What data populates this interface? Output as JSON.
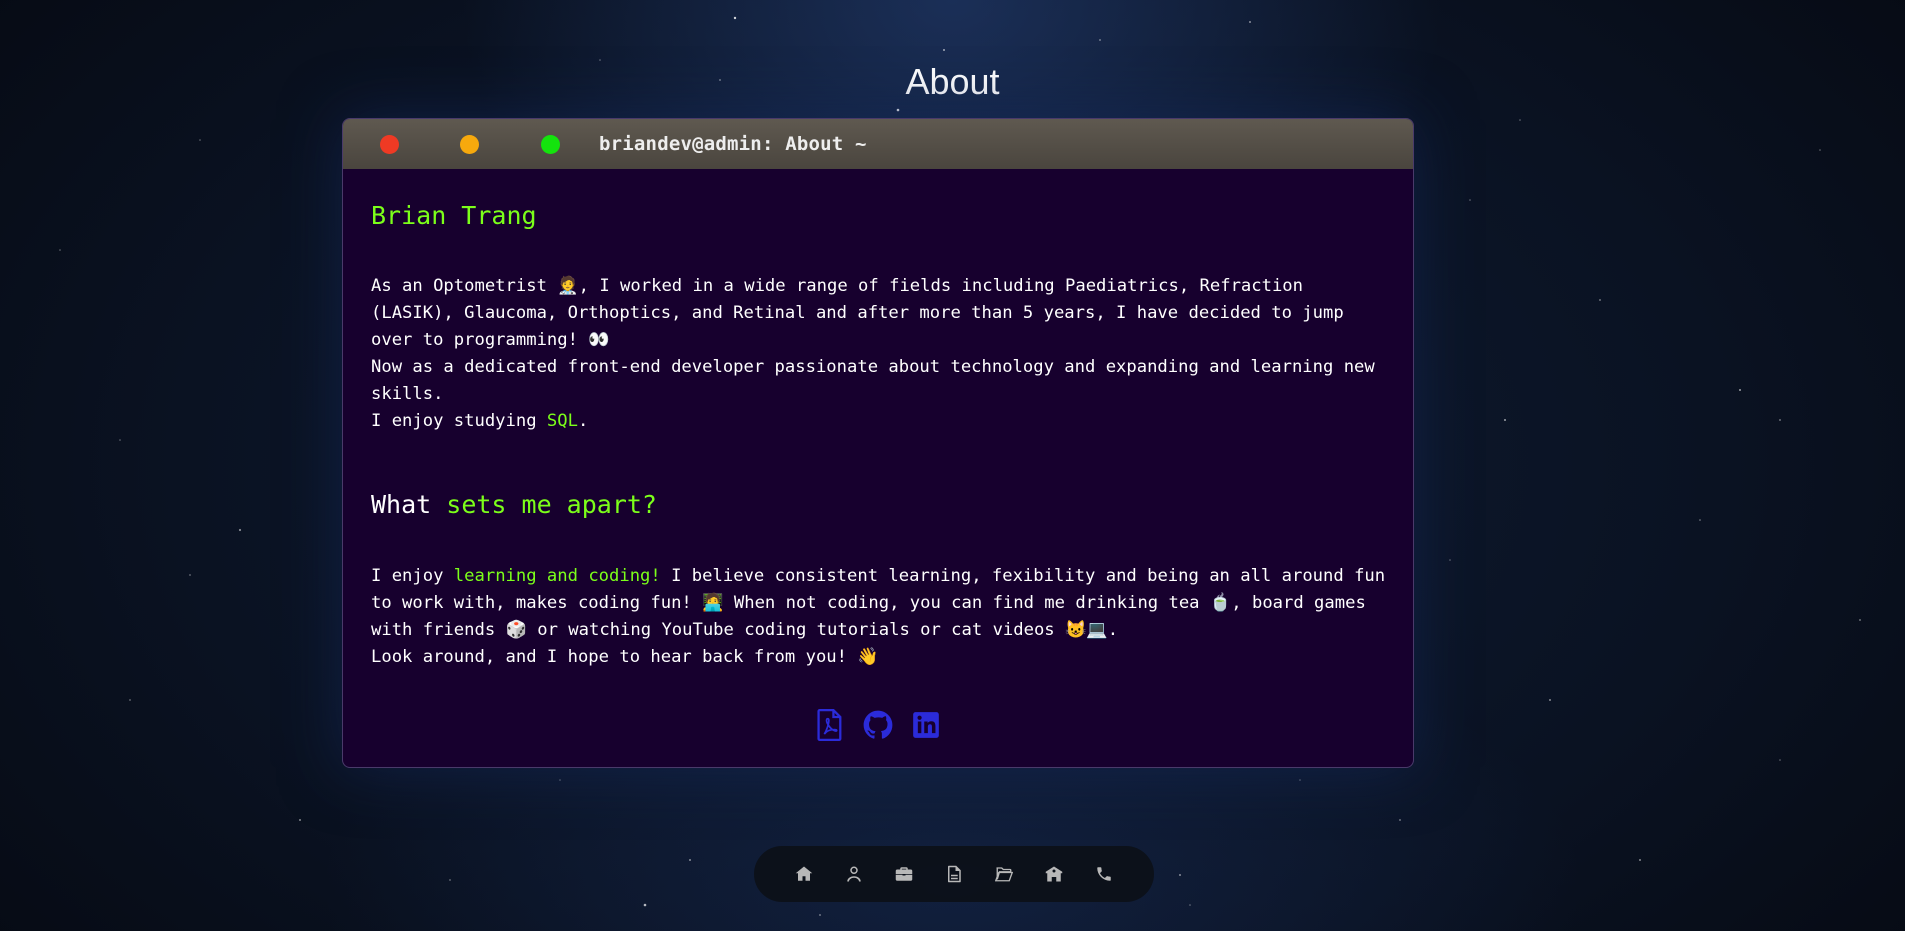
{
  "page": {
    "title": "About"
  },
  "terminal": {
    "title": "briandev@admin: About ~",
    "name": "Brian Trang",
    "intro_line": "As an Optometrist 🧑‍⚕️, I worked in a wide range of fields including Paediatrics, Refraction (LASIK), Glaucoma, Orthoptics, and Retinal and after more than 5 years, I have decided to jump over to programming! 👀",
    "developer_line": "Now as a dedicated front-end developer passionate about technology and expanding and learning new skills.",
    "studying_prefix": "I enjoy studying ",
    "studying_subject": "SQL",
    "studying_suffix": ".",
    "apart_heading_prefix": "What ",
    "apart_heading_highlight": "sets me apart?",
    "apart_prefix": "I enjoy ",
    "apart_highlight": "learning and coding!",
    "apart_rest": " I believe consistent learning, fexibility and being an all around fun to work with, makes coding fun! 🧑‍💻 When not coding, you can find me drinking tea 🍵, board games with friends 🎲 or watching YouTube coding tutorials or cat videos 😺💻.",
    "closing_line": "Look around, and I hope to hear back from you! 👋"
  },
  "socials": [
    {
      "icon": "pdf-file-icon"
    },
    {
      "icon": "github-icon"
    },
    {
      "icon": "linkedin-icon"
    }
  ],
  "nav": [
    {
      "icon": "home-icon"
    },
    {
      "icon": "user-icon"
    },
    {
      "icon": "briefcase-icon"
    },
    {
      "icon": "document-icon"
    },
    {
      "icon": "folder-open-icon"
    },
    {
      "icon": "school-icon"
    },
    {
      "icon": "phone-icon"
    }
  ],
  "colors": {
    "accent_green": "#7cff1a",
    "terminal_bg": "#17002e",
    "social_icon": "#2b2bd9",
    "nav_icon": "#b8b8b8",
    "dot_red": "#ef3a24",
    "dot_yellow": "#f7a90d",
    "dot_green": "#14e30d"
  }
}
